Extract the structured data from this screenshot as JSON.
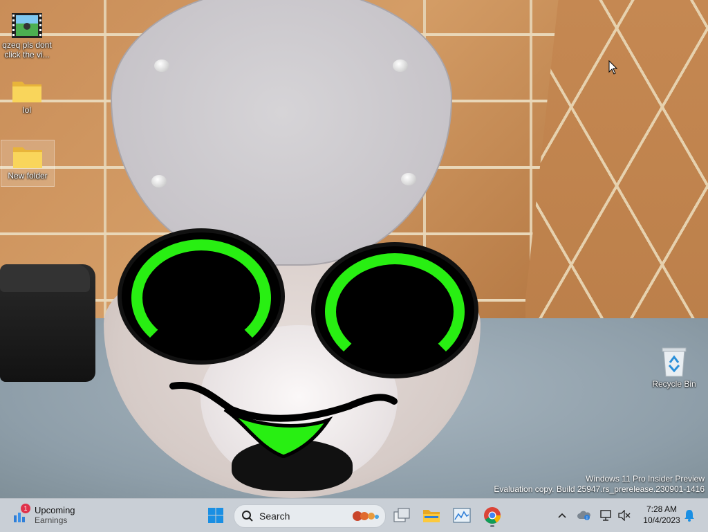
{
  "desktop": {
    "icons": [
      {
        "label": "qzeq pls dont click the vi...",
        "icon": "video-file-icon"
      },
      {
        "label": "lol",
        "icon": "folder-icon"
      },
      {
        "label": "New folder",
        "icon": "folder-icon"
      },
      {
        "label": "Recycle Bin",
        "icon": "recycle-bin-icon"
      }
    ],
    "watermark": {
      "line1": "Windows 11 Pro Insider Preview",
      "line2": "Evaluation copy. Build 25947.rs_prerelease.230901-1416"
    }
  },
  "taskbar": {
    "widget": {
      "badge": "1",
      "title": "Upcoming",
      "subtitle": "Earnings"
    },
    "search": {
      "placeholder": "Search"
    },
    "apps": [
      "start-icon",
      "task-view-icon",
      "file-explorer-icon",
      "photos-icon",
      "chrome-icon"
    ],
    "tray": [
      "chevron-up-icon",
      "onedrive-icon",
      "network-icon",
      "volume-muted-icon",
      "notification-bell-icon"
    ],
    "clock": {
      "time": "7:28 AM",
      "date": "10/4/2023"
    }
  },
  "colors": {
    "taskbar_bg": "#c9cfd6",
    "eye_green": "#28ef12",
    "start_blue": "#1a8fe3"
  }
}
